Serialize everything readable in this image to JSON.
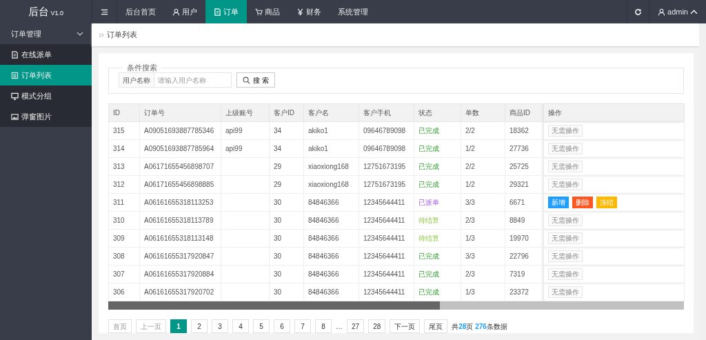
{
  "logo": {
    "title": "后台",
    "version": "V1.0"
  },
  "topnav": [
    {
      "label": "后台首页",
      "selected": false
    },
    {
      "label": "用户",
      "selected": false
    },
    {
      "label": "订单",
      "selected": true
    },
    {
      "label": "商品",
      "selected": false
    },
    {
      "label": "财务",
      "selected": false
    },
    {
      "label": "系统管理",
      "selected": false
    }
  ],
  "user_menu": {
    "name": "admin",
    "expanded": true
  },
  "sidebar": {
    "group": {
      "label": "订单管理",
      "expanded": true
    },
    "items": [
      {
        "label": "在线派单",
        "selected": false
      },
      {
        "label": "订单列表",
        "selected": true
      },
      {
        "label": "模式分组",
        "selected": false
      },
      {
        "label": "弹窗图片",
        "selected": false
      }
    ]
  },
  "breadcrumb": "订单列表",
  "search": {
    "legend": "条件搜索",
    "label": "用户名称",
    "placeholder": "请输入用户名称",
    "button": "搜 索"
  },
  "table": {
    "columns": [
      "ID",
      "订单号",
      "上级账号",
      "客户ID",
      "客户名",
      "客户手机",
      "状态",
      "单数",
      "商品ID",
      "操作"
    ],
    "rows": [
      {
        "cells": [
          "315",
          "A09051693887785346",
          "api99",
          "34",
          "akiko1",
          "09646789098"
        ],
        "status": {
          "text": "已完成",
          "kind": "done"
        },
        "count": "2/2",
        "product_id": "18362",
        "actions": [
          {
            "label": "无需操作",
            "kind": "none"
          }
        ]
      },
      {
        "cells": [
          "314",
          "A09051693887785964",
          "api99",
          "34",
          "akiko1",
          "09646789098"
        ],
        "status": {
          "text": "已完成",
          "kind": "done"
        },
        "count": "1/2",
        "product_id": "27736",
        "actions": [
          {
            "label": "无需操作",
            "kind": "none"
          }
        ]
      },
      {
        "cells": [
          "313",
          "A06171655456898707",
          "",
          "29",
          "xiaoxiong168",
          "12751673195"
        ],
        "status": {
          "text": "已完成",
          "kind": "done"
        },
        "count": "2/2",
        "product_id": "25725",
        "actions": [
          {
            "label": "无需操作",
            "kind": "none"
          }
        ]
      },
      {
        "cells": [
          "312",
          "A06171655456898885",
          "",
          "29",
          "xiaoxiong168",
          "12751673195"
        ],
        "status": {
          "text": "已完成",
          "kind": "done"
        },
        "count": "1/2",
        "product_id": "29321",
        "actions": [
          {
            "label": "无需操作",
            "kind": "none"
          }
        ]
      },
      {
        "cells": [
          "311",
          "A06161655318113253",
          "",
          "30",
          "84846366",
          "12345644411"
        ],
        "status": {
          "text": "已派单",
          "kind": "dispatched"
        },
        "count": "3/3",
        "product_id": "6671",
        "actions": [
          {
            "label": "新增",
            "kind": "add"
          },
          {
            "label": "删除",
            "kind": "delete"
          },
          {
            "label": "冻结",
            "kind": "freeze"
          }
        ]
      },
      {
        "cells": [
          "310",
          "A06161655318113789",
          "",
          "30",
          "84846366",
          "12345644411"
        ],
        "status": {
          "text": "待结算",
          "kind": "pending"
        },
        "count": "2/3",
        "product_id": "8849",
        "actions": [
          {
            "label": "无需操作",
            "kind": "none"
          }
        ]
      },
      {
        "cells": [
          "309",
          "A06161655318113148",
          "",
          "30",
          "84846366",
          "12345644411"
        ],
        "status": {
          "text": "待结算",
          "kind": "pending"
        },
        "count": "1/3",
        "product_id": "19970",
        "actions": [
          {
            "label": "无需操作",
            "kind": "none"
          }
        ]
      },
      {
        "cells": [
          "308",
          "A06161655317920847",
          "",
          "30",
          "84846366",
          "12345644411"
        ],
        "status": {
          "text": "已完成",
          "kind": "done"
        },
        "count": "3/3",
        "product_id": "22796",
        "actions": [
          {
            "label": "无需操作",
            "kind": "none"
          }
        ]
      },
      {
        "cells": [
          "307",
          "A06161655317920884",
          "",
          "30",
          "84846366",
          "12345644411"
        ],
        "status": {
          "text": "已完成",
          "kind": "done"
        },
        "count": "2/3",
        "product_id": "7319",
        "actions": [
          {
            "label": "无需操作",
            "kind": "none"
          }
        ]
      },
      {
        "cells": [
          "306",
          "A06161655317920702",
          "",
          "30",
          "84846366",
          "12345644411"
        ],
        "status": {
          "text": "已完成",
          "kind": "done"
        },
        "count": "1/3",
        "product_id": "23372",
        "actions": [
          {
            "label": "无需操作",
            "kind": "none"
          }
        ]
      }
    ]
  },
  "pagination": {
    "items": [
      {
        "label": "首页",
        "kind": "nav",
        "disabled": true,
        "selected": false
      },
      {
        "label": "上一页",
        "kind": "nav",
        "disabled": true,
        "selected": false
      },
      {
        "label": "1",
        "kind": "page",
        "disabled": false,
        "selected": true
      },
      {
        "label": "2",
        "kind": "page",
        "disabled": false,
        "selected": false
      },
      {
        "label": "3",
        "kind": "page",
        "disabled": false,
        "selected": false
      },
      {
        "label": "4",
        "kind": "page",
        "disabled": false,
        "selected": false
      },
      {
        "label": "5",
        "kind": "page",
        "disabled": false,
        "selected": false
      },
      {
        "label": "6",
        "kind": "page",
        "disabled": false,
        "selected": false
      },
      {
        "label": "7",
        "kind": "page",
        "disabled": false,
        "selected": false
      },
      {
        "label": "8",
        "kind": "page",
        "disabled": false,
        "selected": false
      },
      {
        "label": "…",
        "kind": "ellipsis"
      },
      {
        "label": "27",
        "kind": "page",
        "disabled": false,
        "selected": false
      },
      {
        "label": "28",
        "kind": "page",
        "disabled": false,
        "selected": false
      },
      {
        "label": "下一页",
        "kind": "nav",
        "disabled": false,
        "selected": false
      },
      {
        "label": "尾页",
        "kind": "nav",
        "disabled": false,
        "selected": false
      }
    ],
    "summary": "共**28**页 **276**条数据"
  }
}
